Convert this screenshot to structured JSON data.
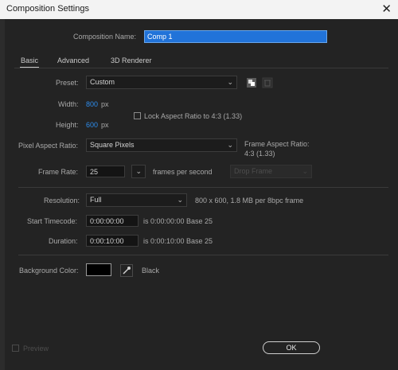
{
  "window": {
    "title": "Composition Settings",
    "close_glyph": "✕"
  },
  "comp_name": {
    "label": "Composition Name:",
    "value": "Comp 1"
  },
  "tabs": [
    "Basic",
    "Advanced",
    "3D Renderer"
  ],
  "preset": {
    "label": "Preset:",
    "value": "Custom"
  },
  "width": {
    "label": "Width:",
    "value": "800",
    "unit": "px"
  },
  "height": {
    "label": "Height:",
    "value": "600",
    "unit": "px"
  },
  "lock_aspect": {
    "label": "Lock Aspect Ratio to 4:3 (1.33)",
    "checked": false
  },
  "pixel_aspect": {
    "label": "Pixel Aspect Ratio:",
    "value": "Square Pixels",
    "frame_aspect_label": "Frame Aspect Ratio:",
    "frame_aspect_value": "4:3 (1.33)"
  },
  "frame_rate": {
    "label": "Frame Rate:",
    "value": "25",
    "unit": "frames per second",
    "drop_frame": "Drop Frame"
  },
  "resolution": {
    "label": "Resolution:",
    "value": "Full",
    "info": "800 x 600, 1.8 MB per 8bpc frame"
  },
  "start_timecode": {
    "label": "Start Timecode:",
    "value": "0:00:00:00",
    "info": "is 0:00:00:00  Base 25"
  },
  "duration": {
    "label": "Duration:",
    "value": "0:00:10:00",
    "info": "is 0:00:10:00  Base 25"
  },
  "background": {
    "label": "Background Color:",
    "color": "#000000",
    "name": "Black"
  },
  "footer": {
    "preview_label": "Preview",
    "ok_label": "OK"
  },
  "icons": {
    "dropdown": "chevron-down-icon",
    "eyedropper": "eyedropper-icon",
    "save_preset": "save-preset-icon",
    "delete_preset": "trash-icon"
  }
}
